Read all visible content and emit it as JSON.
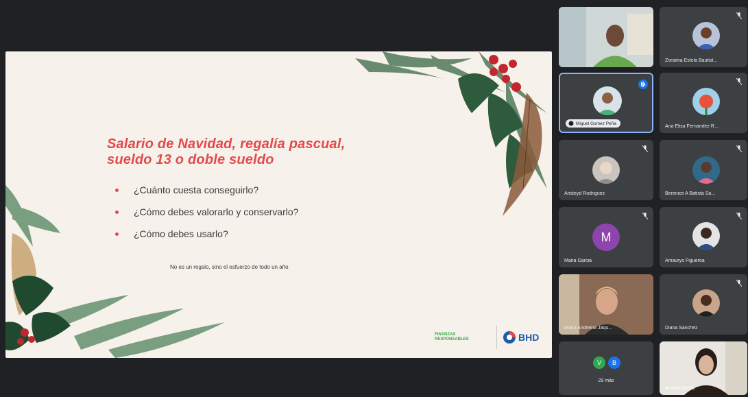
{
  "slide": {
    "title_line1": "Salario de Navidad, regalía pascual,",
    "title_line2": "sueldo 13 o doble sueldo",
    "bullets": [
      "¿Cuánto cuesta conseguirlo?",
      "¿Cómo debes valorarlo y conservarlo?",
      "¿Cómo debes usarlo?"
    ],
    "caption": "No es un regalo, sino el esfuerzo de todo un año",
    "logo_left_line1": "FINANZAS",
    "logo_left_line2": "RESPONSABLES",
    "logo_right": "BHD",
    "accent_color": "#e24a4c"
  },
  "participants": [
    {
      "name": "",
      "kind": "video",
      "icon": "mic-muted-icon"
    },
    {
      "name": "Zoraima Estela Bautist...",
      "kind": "photo",
      "icon": "mic-muted-icon"
    },
    {
      "name": "Miguel Gomez Peña",
      "kind": "speaking",
      "icon": "speaking-icon"
    },
    {
      "name": "Ana Elisa Fernandez R...",
      "kind": "photo",
      "icon": "mic-muted-icon"
    },
    {
      "name": "Aristeyd Rodriguez",
      "kind": "photo",
      "icon": "mic-muted-icon"
    },
    {
      "name": "Berenice A Batista Sa...",
      "kind": "photo",
      "icon": "mic-muted-icon"
    },
    {
      "name": "Maria Garcia",
      "kind": "letter",
      "letter": "M",
      "icon": "mic-muted-icon"
    },
    {
      "name": "Amauryo Figueroa",
      "kind": "photo",
      "icon": "mic-muted-icon"
    },
    {
      "name": "Maria Andreina Jáqu...",
      "kind": "video",
      "icon": "mic-muted-icon"
    },
    {
      "name": "Diana Sanchez",
      "kind": "photo",
      "icon": "mic-muted-icon"
    },
    {
      "name": "29 más",
      "kind": "others",
      "letters": [
        "V",
        "B"
      ]
    },
    {
      "name": "Anabel Oreba",
      "kind": "video",
      "icon": "mic-muted-icon"
    }
  ],
  "colors": {
    "background": "#202124",
    "tile": "#3c4043",
    "speaking": "#8ab4f8",
    "letter_avatar": "#8e44ad"
  }
}
